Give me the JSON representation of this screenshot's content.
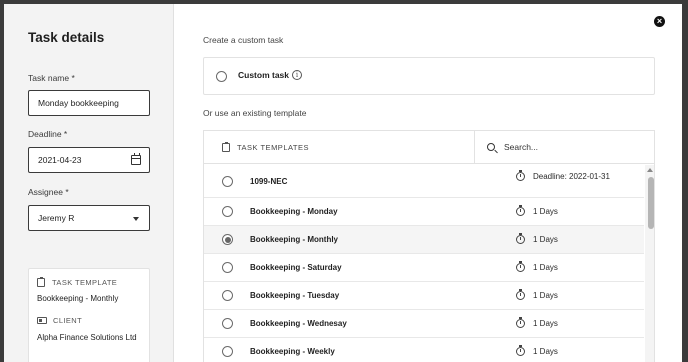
{
  "sidebar": {
    "title": "Task details",
    "task_name": {
      "label": "Task name *",
      "value": "Monday bookkeeping"
    },
    "deadline": {
      "label": "Deadline *",
      "value": "2021-04-23"
    },
    "assignee": {
      "label": "Assignee *",
      "value": "Jeremy R"
    },
    "summary": {
      "template_heading": "TASK TEMPLATE",
      "template_value": "Bookkeeping - Monthly",
      "client_heading": "CLIENT",
      "client_value": "Alpha Finance Solutions Ltd"
    }
  },
  "main": {
    "custom_heading": "Create a custom task",
    "custom_option": "Custom task",
    "info_glyph": "i",
    "template_heading": "Or use an existing template",
    "table": {
      "column_header": "TASK TEMPLATES",
      "search_placeholder": "Search..."
    },
    "templates": [
      {
        "name": "1099-NEC",
        "duration": "Deadline: 2022-01-31",
        "selected": false
      },
      {
        "name": "Bookkeeping - Monday",
        "duration": "1 Days",
        "selected": false
      },
      {
        "name": "Bookkeeping - Monthly",
        "duration": "1 Days",
        "selected": true
      },
      {
        "name": "Bookkeeping - Saturday",
        "duration": "1 Days",
        "selected": false
      },
      {
        "name": "Bookkeeping - Tuesday",
        "duration": "1 Days",
        "selected": false
      },
      {
        "name": "Bookkeeping - Wednesay",
        "duration": "1 Days",
        "selected": false
      },
      {
        "name": "Bookkeeping - Weekly",
        "duration": "1 Days",
        "selected": false
      }
    ]
  },
  "close_glyph": "×",
  "colors": {
    "backdrop": "#3b3b3b",
    "sidebar_bg": "#f3f3f3",
    "selected_row": "#f5f5f5"
  },
  "icons": [
    "close-icon",
    "calendar-icon",
    "chevron-down-icon",
    "info-icon",
    "clipboard-icon",
    "search-icon",
    "stopwatch-icon",
    "id-card-icon"
  ]
}
